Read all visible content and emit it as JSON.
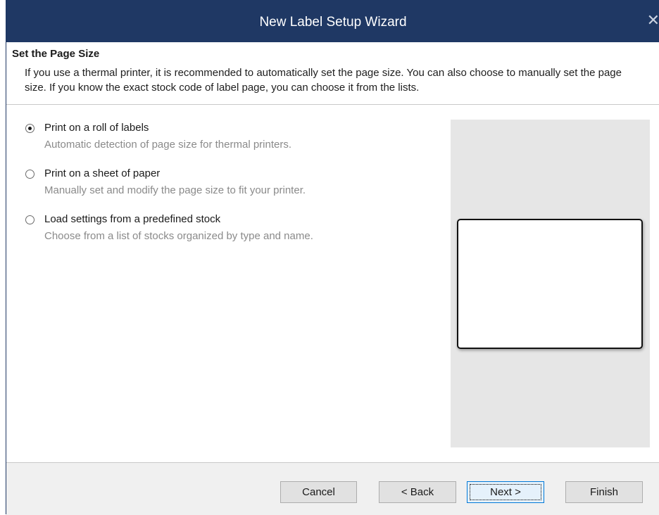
{
  "window": {
    "title": "New Label Setup Wizard",
    "close_glyph": "✕",
    "accent_color": "#1f3864"
  },
  "header": {
    "title": "Set the Page Size",
    "description": "If you use a thermal printer, it is recommended to automatically set the page size. You can also choose to manually set the page size. If you know the exact stock code of label page, you can choose it from the lists."
  },
  "options": [
    {
      "label": "Print on a roll of labels",
      "description": "Automatic detection of page size for thermal printers.",
      "selected": true
    },
    {
      "label": "Print on a sheet of paper",
      "description": "Manually set and modify the page size to fit your printer.",
      "selected": false
    },
    {
      "label": "Load settings from a predefined stock",
      "description": "Choose from a list of stocks organized by type and name.",
      "selected": false
    }
  ],
  "buttons": {
    "cancel": "Cancel",
    "back": "< Back",
    "next": "Next >",
    "finish": "Finish"
  }
}
